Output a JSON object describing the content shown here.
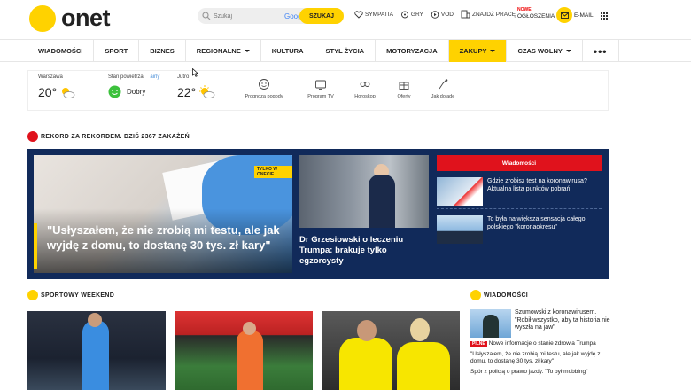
{
  "header": {
    "logo_text": "onet",
    "search_placeholder": "Szukaj",
    "search_engine": "Google",
    "search_button": "SZUKAJ",
    "links": [
      "SYMPATIA",
      "GRY",
      "VOD",
      "ZNAJDŹ PRACĘ"
    ],
    "ogloszenia_new": "NOWE",
    "ogloszenia": "OGŁOSZENIA",
    "email": "E-MAIL"
  },
  "nav": {
    "items": [
      "WIADOMOŚCI",
      "SPORT",
      "BIZNES",
      "REGIONALNE",
      "KULTURA",
      "STYL ŻYCIA",
      "MOTORYZACJA",
      "ZAKUPY",
      "CZAS WOLNY"
    ],
    "more": "•••"
  },
  "strip": {
    "weather": {
      "city": "Warszawa",
      "temp": "20°"
    },
    "air": {
      "label": "Stan powietrza",
      "source": "airly",
      "value": "Dobry"
    },
    "tomorrow": {
      "label": "Jutro",
      "temp": "22°"
    },
    "services": [
      "Prognoza pogody",
      "Program TV",
      "Horoskop",
      "Oferty",
      "Jak dojadę"
    ]
  },
  "record": {
    "heading": "REKORD ZA REKORDEM. DZIŚ 2367 ZAKAŻEŃ",
    "main_badge": "TYLKO W ONECIE",
    "main_title": "\"Usłyszałem, że nie zrobią mi testu, ale jak wyjdę z domu, to dostanę 30 tys. zł kary\"",
    "mid_title": "Dr Grzesiowski o leczeniu Trumpa: brakuje tylko egzorcysty",
    "right_button": "Wiadomości",
    "right_news": [
      "Gdzie zrobisz test na koronawirusa? Aktualna lista punktów pobrań",
      "To była największa sensacja całego polskiego \"koronaokresu\""
    ]
  },
  "sport": {
    "heading": "SPORTOWY WEEKEND"
  },
  "side": {
    "heading": "WIADOMOŚCI",
    "top_news": "Szumowski z koronawirusem. \"Robił wszystko, aby ta historia nie wyszła na jaw\"",
    "pilne": "PILNE",
    "lines": [
      "Nowe informacje o stanie zdrowia Trumpa",
      "\"Usłyszałem, że nie zrobią mi testu, ale jak wyjdę z domu, to dostanę 30 tys. zł kary\"",
      "Spór z policją o prawo jazdy. \"To był mobbing\""
    ]
  },
  "colors": {
    "brand": "#ffd200",
    "hero_bg": "#112a5a",
    "alert": "#e0121c"
  }
}
